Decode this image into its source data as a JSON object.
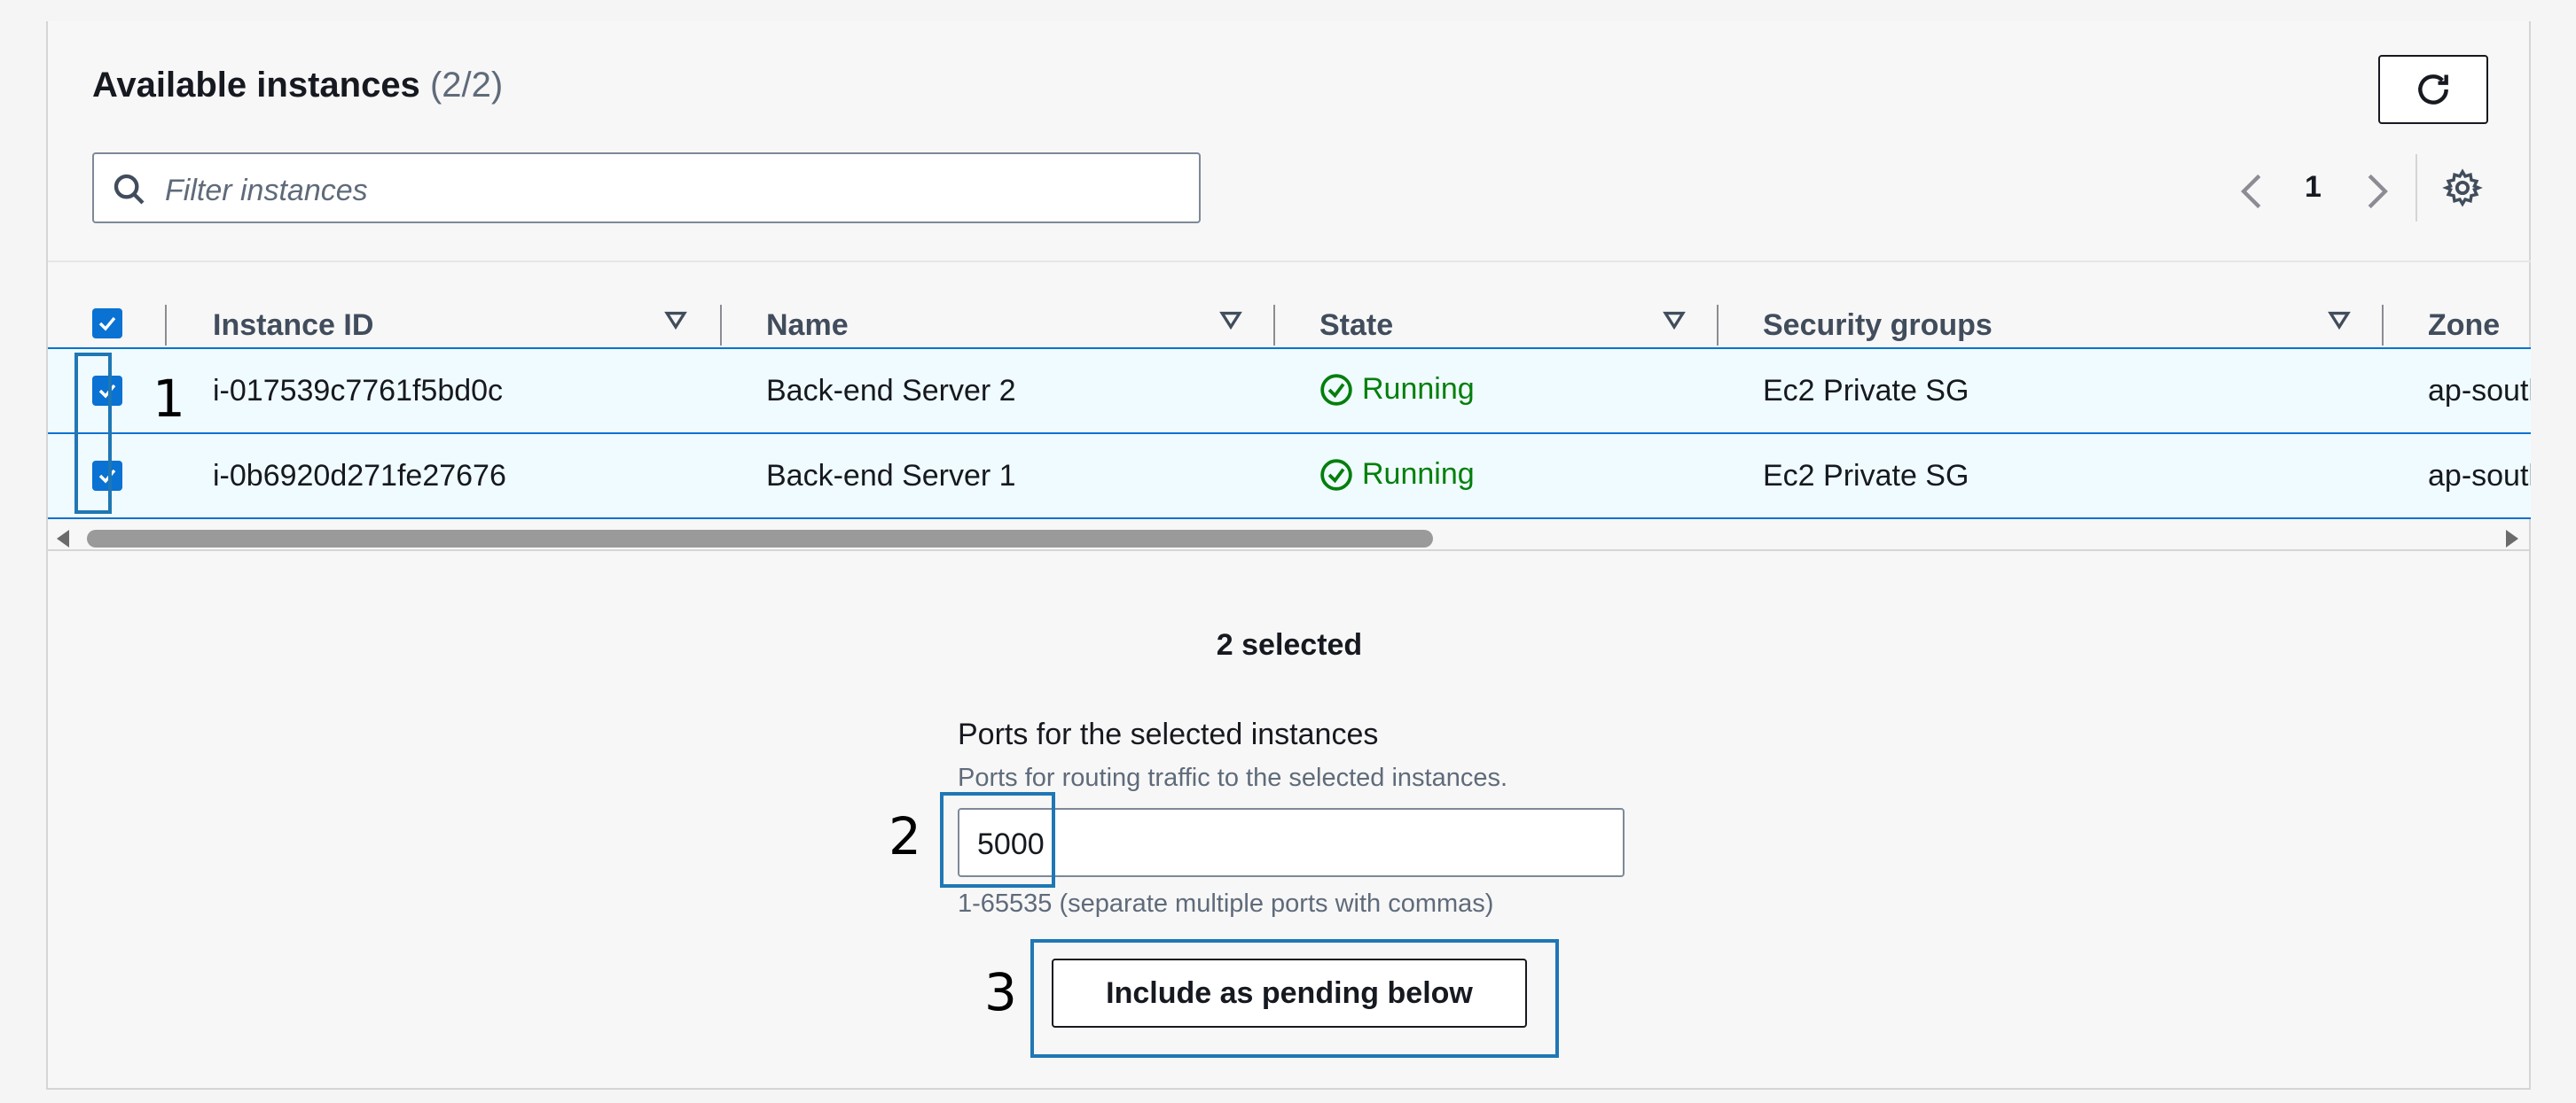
{
  "header": {
    "title": "Available instances",
    "count": "(2/2)"
  },
  "search": {
    "placeholder": "Filter instances"
  },
  "pagination": {
    "current_page": "1"
  },
  "table": {
    "columns": [
      "Instance ID",
      "Name",
      "State",
      "Security groups",
      "Zone"
    ],
    "rows": [
      {
        "instance_id": "i-017539c7761f5bd0c",
        "name": "Back-end Server 2",
        "state": "Running",
        "security_groups": "Ec2 Private SG",
        "zone": "ap-south"
      },
      {
        "instance_id": "i-0b6920d271fe27676",
        "name": "Back-end Server 1",
        "state": "Running",
        "security_groups": "Ec2 Private SG",
        "zone": "ap-south"
      }
    ]
  },
  "selection": {
    "text": "2 selected"
  },
  "ports": {
    "label": "Ports for the selected instances",
    "description": "Ports for routing traffic to the selected instances.",
    "value": "5000",
    "hint": "1-65535 (separate multiple ports with commas)"
  },
  "actions": {
    "include_label": "Include as pending below"
  },
  "annotations": [
    "1",
    "2",
    "3"
  ],
  "colors": {
    "accent": "#0972d3",
    "running": "#037f0c",
    "annotation": "#1f77b4"
  }
}
